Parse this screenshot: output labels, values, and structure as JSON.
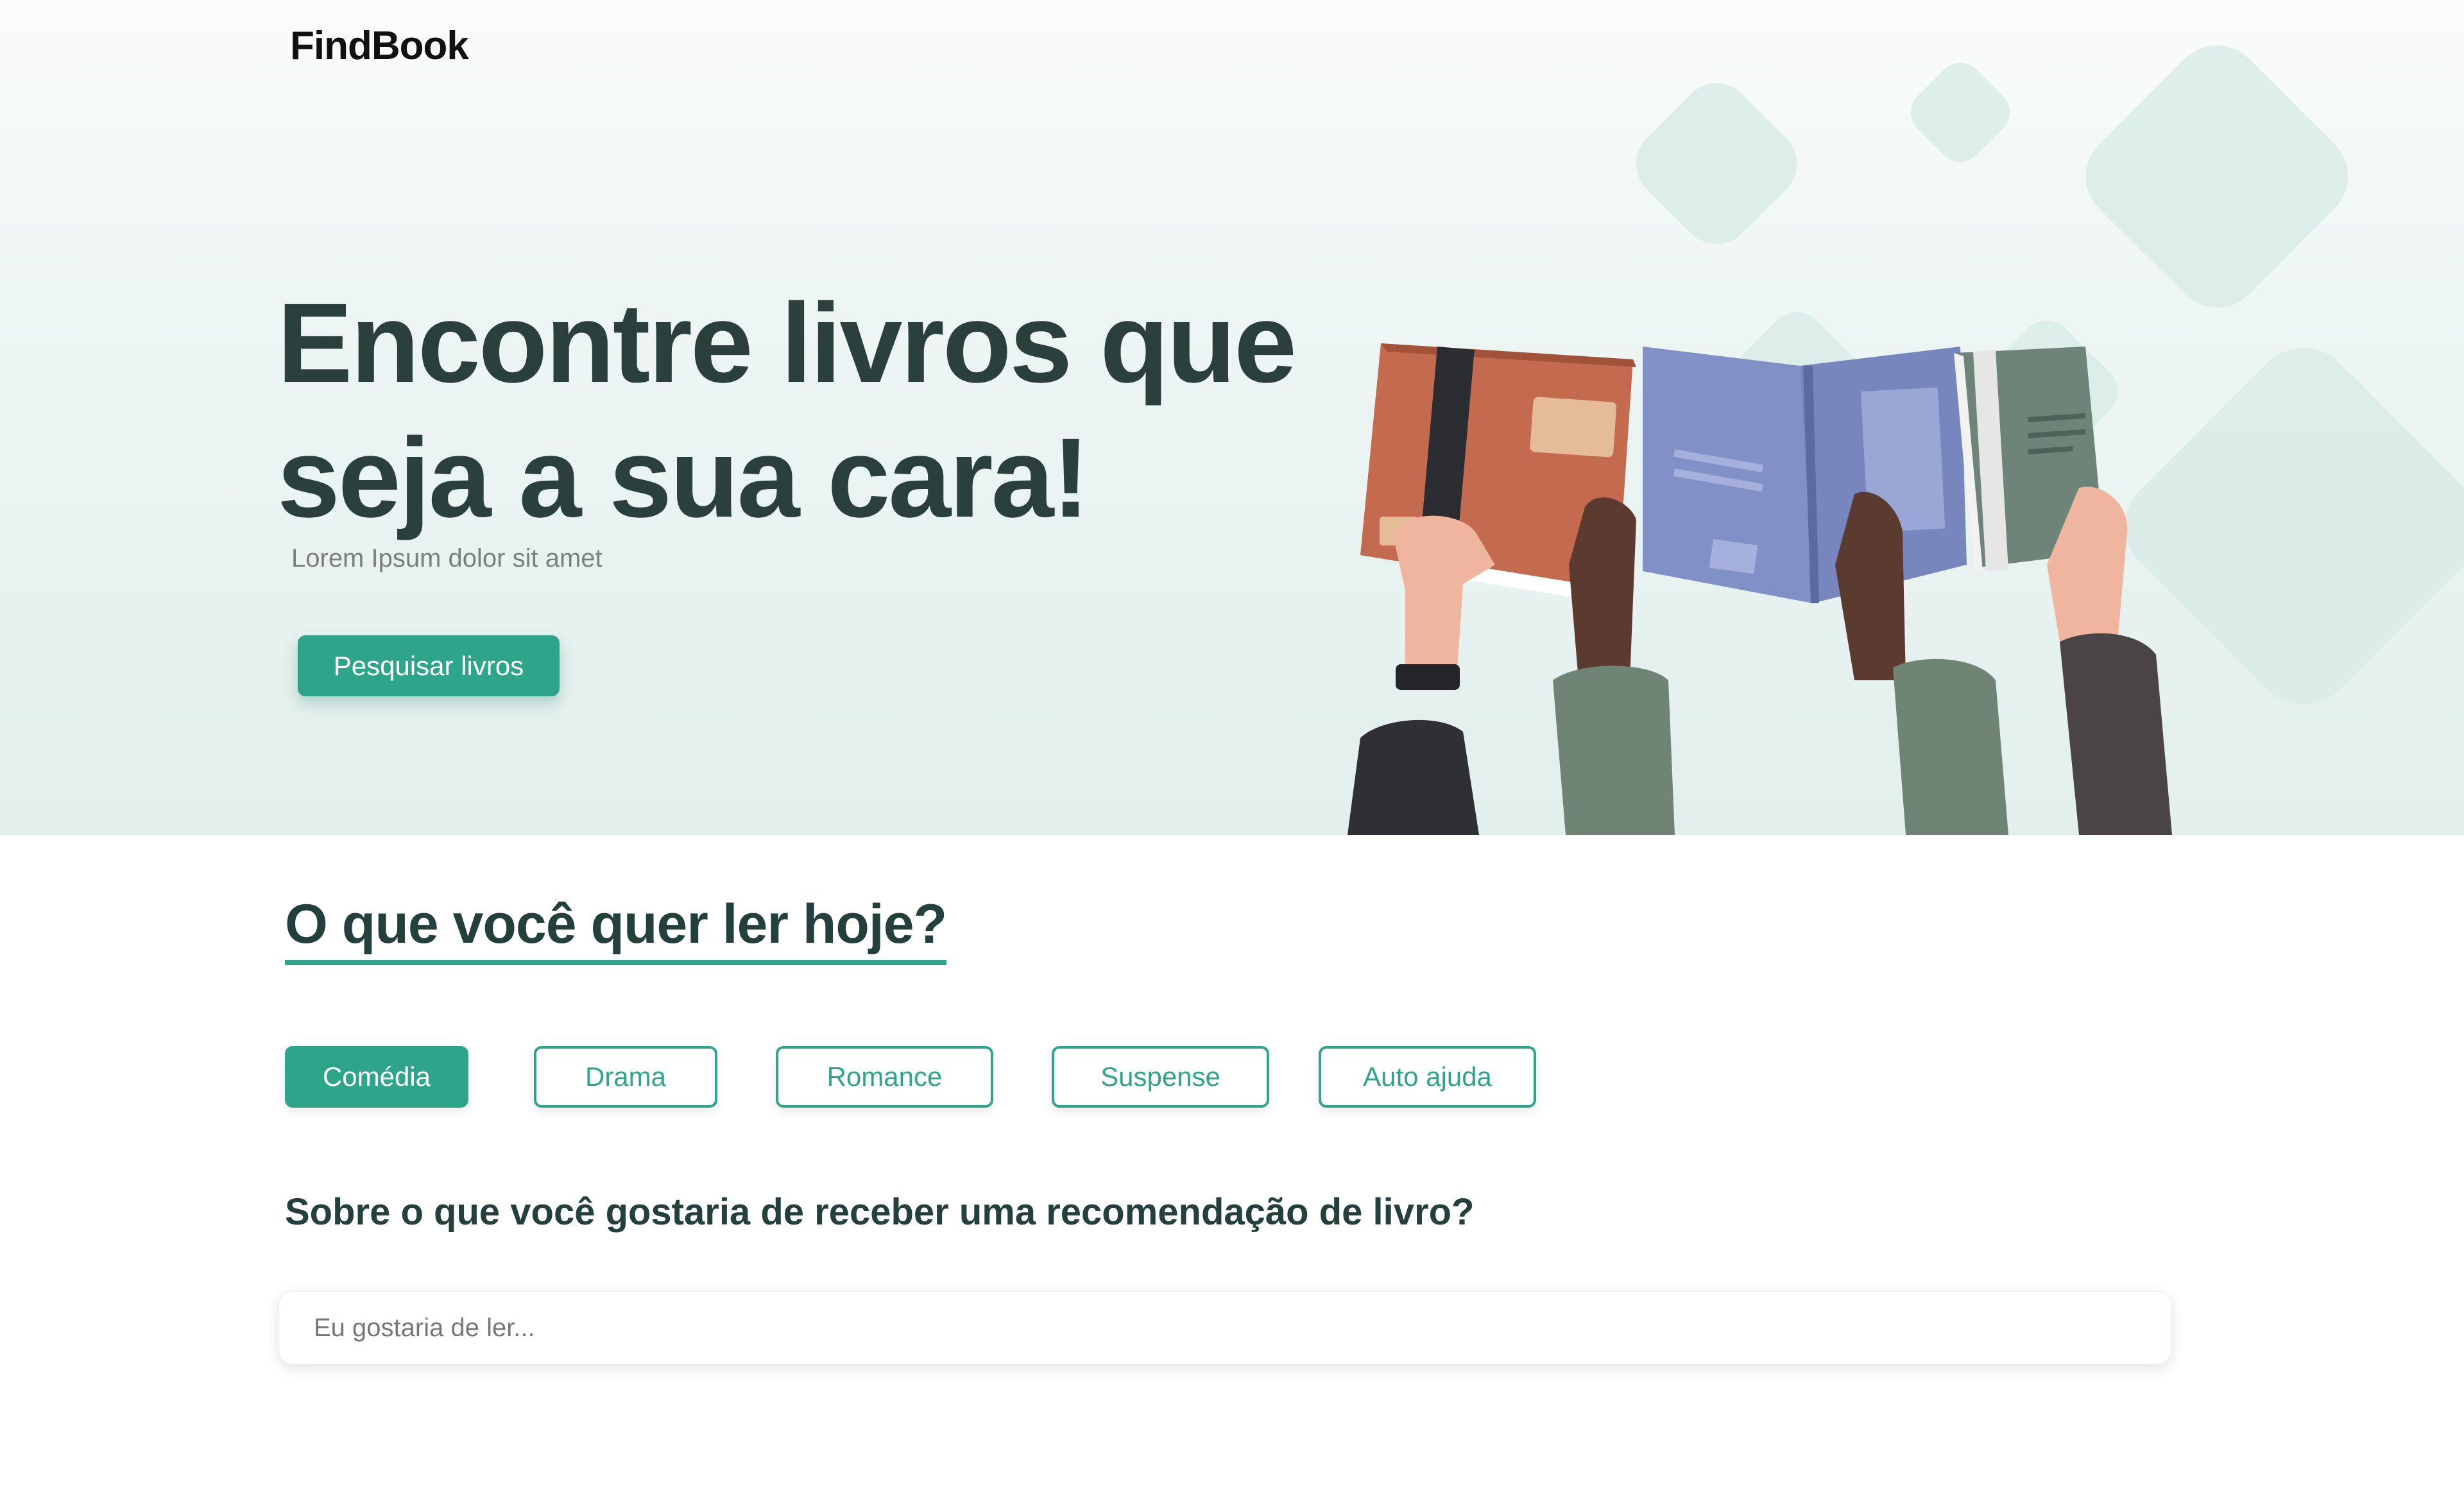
{
  "brand": {
    "logo": "FindBook"
  },
  "hero": {
    "headline_line1": "Encontre livros que",
    "headline_line2": "seja a sua cara!",
    "subtext": "Lorem Ipsum dolor sit amet",
    "cta_label": "Pesquisar livros"
  },
  "genres": {
    "title": "O que você quer ler hoje?",
    "items": [
      {
        "label": "Comédia",
        "active": true
      },
      {
        "label": "Drama",
        "active": false
      },
      {
        "label": "Romance",
        "active": false
      },
      {
        "label": "Suspense",
        "active": false
      },
      {
        "label": "Auto ajuda",
        "active": false
      }
    ]
  },
  "recommendation": {
    "question": "Sobre o que você gostaria de receber uma recomendação de livro?",
    "input_placeholder": "Eu gostaria de ler...",
    "input_value": ""
  },
  "colors": {
    "accent": "#2ea58a",
    "heading": "#2b3f3c",
    "hero_bg": "#e2efed"
  },
  "icons": {
    "illustration": "hands-holding-books-illustration"
  }
}
